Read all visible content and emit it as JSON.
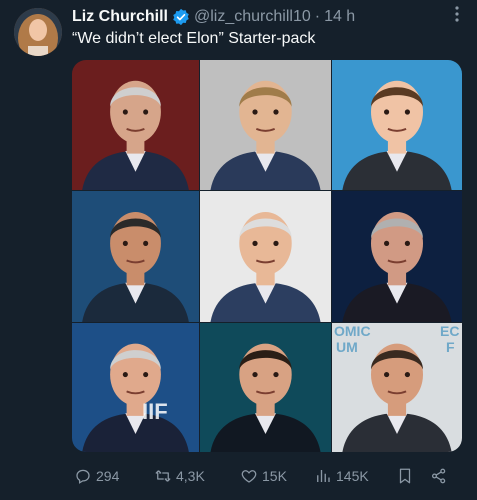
{
  "author": {
    "display_name": "Liz Churchill",
    "handle": "@liz_churchill10",
    "separator": "·",
    "timestamp": "14 h"
  },
  "tweet": {
    "text": "“We didn’t elect Elon” Starter-pack"
  },
  "media": {
    "images": [
      {
        "bg": "#6b1e1e",
        "hair": "#cfcfcf",
        "skin": "#d6a58a",
        "suit": "#1f2a44"
      },
      {
        "bg": "#bfbfbf",
        "hair": "#a07c4a",
        "skin": "#e2b592",
        "suit": "#2a3a5a"
      },
      {
        "bg": "#3a97cf",
        "hair": "#5a3a22",
        "skin": "#f0c3a5",
        "suit": "#2b2f36"
      },
      {
        "bg": "#1e4d78",
        "hair": "#2a2a2a",
        "skin": "#c98d6b",
        "suit": "#1b2a3c"
      },
      {
        "bg": "#e9e9e9",
        "hair": "#dddddd",
        "skin": "#e8b897",
        "suit": "#2c3e60"
      },
      {
        "bg": "#0d2040",
        "hair": "#b0b0b0",
        "skin": "#d19a84",
        "suit": "#1a1a24"
      },
      {
        "bg": "#1d4f87",
        "hair": "#cfcfcf",
        "skin": "#e0a98c",
        "suit": "#1a2238"
      },
      {
        "bg": "#0f4a5a",
        "hair": "#2a1e16",
        "skin": "#d8a283",
        "suit": "#111822"
      },
      {
        "bg": "#d9dde0",
        "hair": "#3a2a20",
        "skin": "#d69c7c",
        "suit": "#2a2e36"
      }
    ],
    "overlay_texts": [
      "IIF",
      "OMIC",
      "UM",
      "EC",
      "F"
    ]
  },
  "actions": {
    "replies": "294",
    "reposts": "4,3K",
    "likes": "15K",
    "views": "145K"
  },
  "colors": {
    "background": "#15202b",
    "text": "#f7f9f9",
    "muted": "#8b98a5",
    "verified": "#1d9bf0"
  }
}
